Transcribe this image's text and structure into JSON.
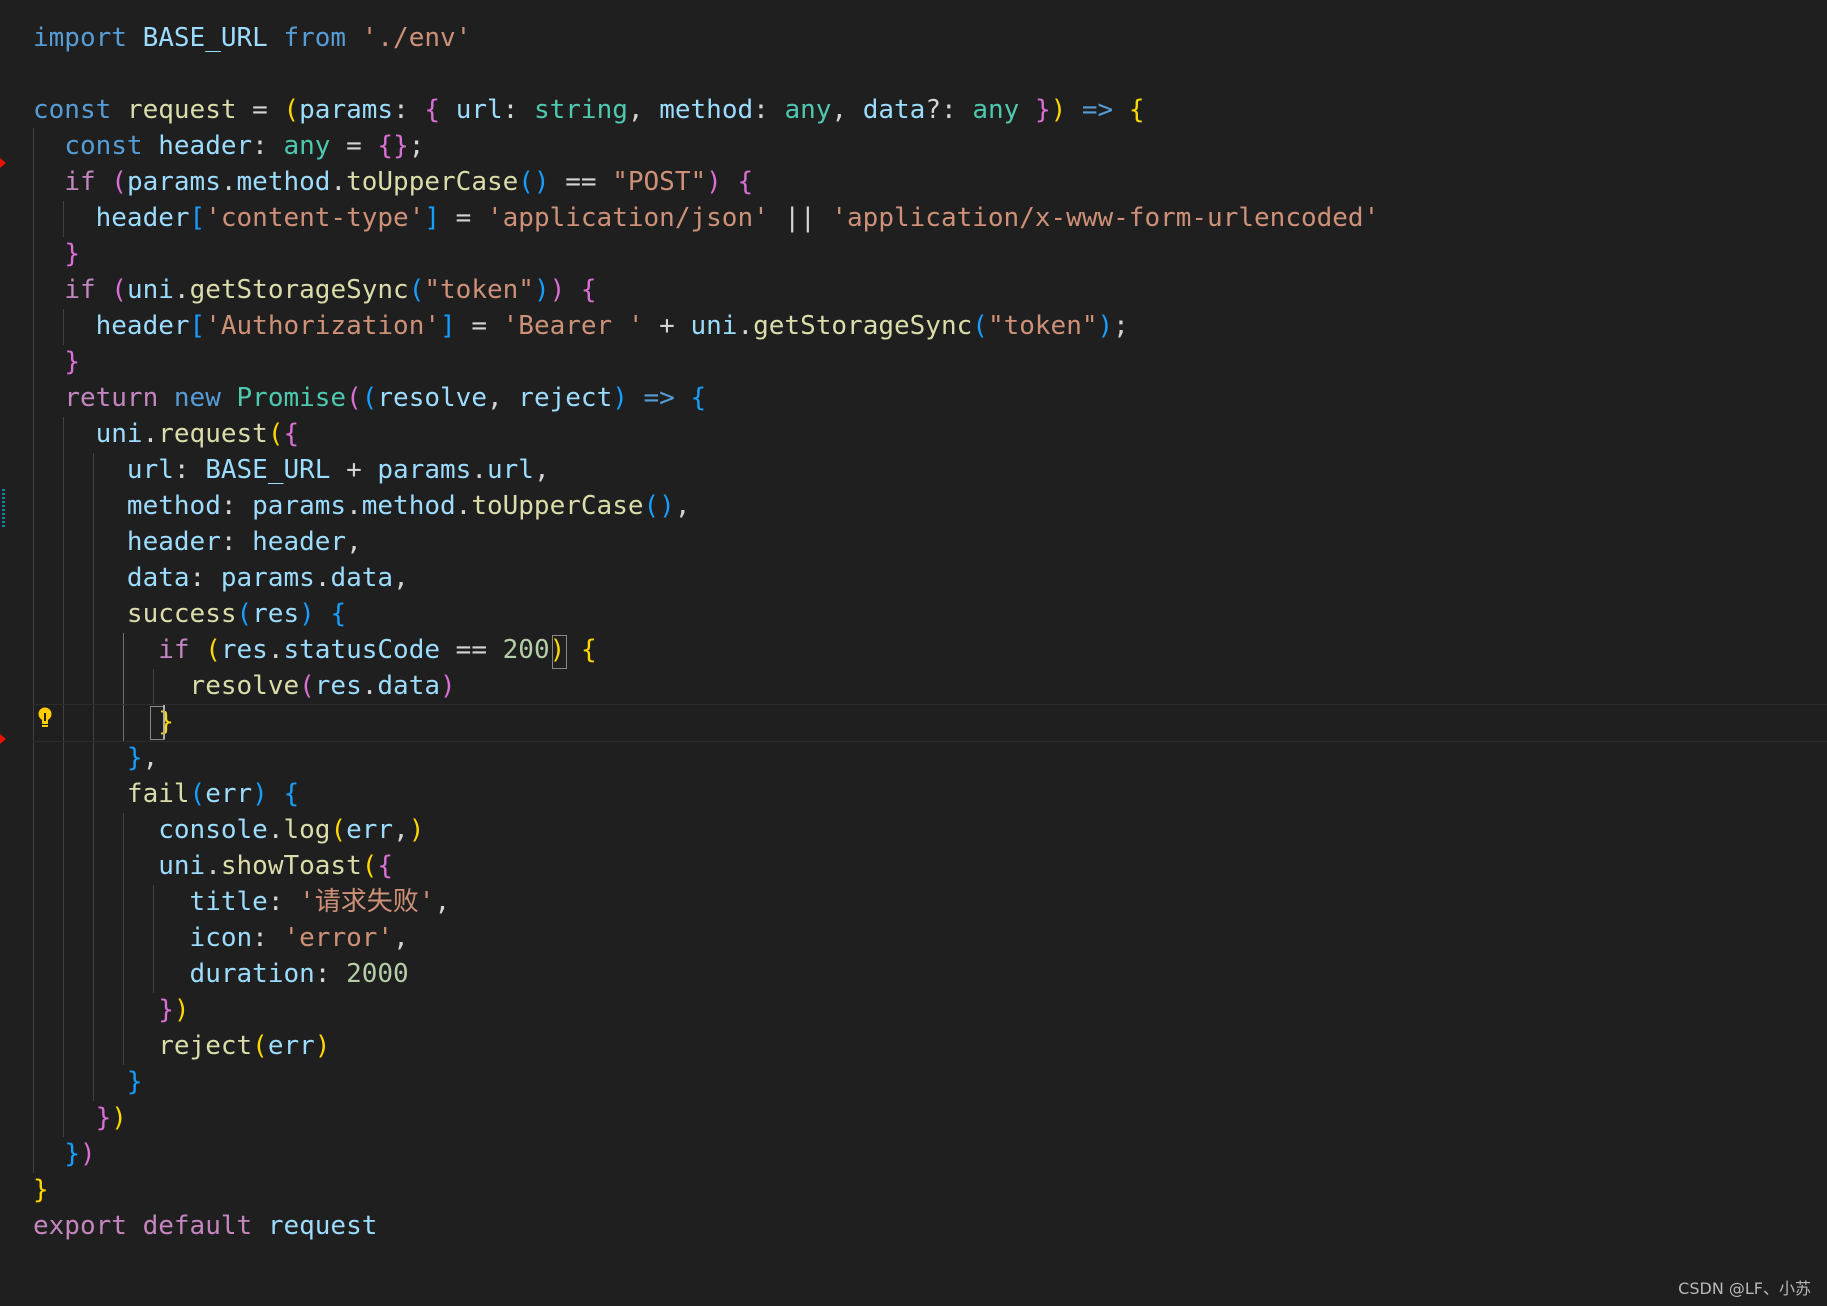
{
  "editor": {
    "language": "typescript",
    "lines": [
      [
        [
          "kw",
          "import"
        ],
        [
          "op",
          " "
        ],
        [
          "var",
          "BASE_URL"
        ],
        [
          "op",
          " "
        ],
        [
          "kw",
          "from"
        ],
        [
          "op",
          " "
        ],
        [
          "str",
          "'./env'"
        ]
      ],
      [],
      [
        [
          "kw",
          "const"
        ],
        [
          "op",
          " "
        ],
        [
          "fn",
          "request"
        ],
        [
          "op",
          " = "
        ],
        [
          "br1",
          "("
        ],
        [
          "var",
          "params"
        ],
        [
          "op",
          ": "
        ],
        [
          "br2",
          "{"
        ],
        [
          "op",
          " "
        ],
        [
          "var",
          "url"
        ],
        [
          "op",
          ": "
        ],
        [
          "type",
          "string"
        ],
        [
          "op",
          ", "
        ],
        [
          "var",
          "method"
        ],
        [
          "op",
          ": "
        ],
        [
          "type",
          "any"
        ],
        [
          "op",
          ", "
        ],
        [
          "var",
          "data"
        ],
        [
          "op",
          "?: "
        ],
        [
          "type",
          "any"
        ],
        [
          "op",
          " "
        ],
        [
          "br2",
          "}"
        ],
        [
          "br1",
          ")"
        ],
        [
          "op",
          " "
        ],
        [
          "kw",
          "=>"
        ],
        [
          "op",
          " "
        ],
        [
          "br1",
          "{"
        ]
      ],
      [
        [
          "op",
          "  "
        ],
        [
          "kw",
          "const"
        ],
        [
          "op",
          " "
        ],
        [
          "var",
          "header"
        ],
        [
          "op",
          ": "
        ],
        [
          "type",
          "any"
        ],
        [
          "op",
          " = "
        ],
        [
          "br2",
          "{}"
        ],
        [
          "op",
          ";"
        ]
      ],
      [
        [
          "op",
          "  "
        ],
        [
          "ctl",
          "if"
        ],
        [
          "op",
          " "
        ],
        [
          "br2",
          "("
        ],
        [
          "var",
          "params"
        ],
        [
          "op",
          "."
        ],
        [
          "var",
          "method"
        ],
        [
          "op",
          "."
        ],
        [
          "fn",
          "toUpperCase"
        ],
        [
          "br3",
          "()"
        ],
        [
          "op",
          " == "
        ],
        [
          "str",
          "\"POST\""
        ],
        [
          "br2",
          ")"
        ],
        [
          "op",
          " "
        ],
        [
          "br2",
          "{"
        ]
      ],
      [
        [
          "op",
          "    "
        ],
        [
          "var",
          "header"
        ],
        [
          "br3",
          "["
        ],
        [
          "str",
          "'content-type'"
        ],
        [
          "br3",
          "]"
        ],
        [
          "op",
          " = "
        ],
        [
          "str",
          "'application/json'"
        ],
        [
          "op",
          " || "
        ],
        [
          "str",
          "'application/x-www-form-urlencoded'"
        ]
      ],
      [
        [
          "op",
          "  "
        ],
        [
          "br2",
          "}"
        ]
      ],
      [
        [
          "op",
          "  "
        ],
        [
          "ctl",
          "if"
        ],
        [
          "op",
          " "
        ],
        [
          "br2",
          "("
        ],
        [
          "var",
          "uni"
        ],
        [
          "op",
          "."
        ],
        [
          "fn",
          "getStorageSync"
        ],
        [
          "br3",
          "("
        ],
        [
          "str",
          "\"token\""
        ],
        [
          "br3",
          ")"
        ],
        [
          "br2",
          ")"
        ],
        [
          "op",
          " "
        ],
        [
          "br2",
          "{"
        ]
      ],
      [
        [
          "op",
          "    "
        ],
        [
          "var",
          "header"
        ],
        [
          "br3",
          "["
        ],
        [
          "str",
          "'Authorization'"
        ],
        [
          "br3",
          "]"
        ],
        [
          "op",
          " = "
        ],
        [
          "str",
          "'Bearer '"
        ],
        [
          "op",
          " + "
        ],
        [
          "var",
          "uni"
        ],
        [
          "op",
          "."
        ],
        [
          "fn",
          "getStorageSync"
        ],
        [
          "br3",
          "("
        ],
        [
          "str",
          "\"token\""
        ],
        [
          "br3",
          ")"
        ],
        [
          "op",
          ";"
        ]
      ],
      [
        [
          "op",
          "  "
        ],
        [
          "br2",
          "}"
        ]
      ],
      [
        [
          "op",
          "  "
        ],
        [
          "ctl",
          "return"
        ],
        [
          "op",
          " "
        ],
        [
          "kw",
          "new"
        ],
        [
          "op",
          " "
        ],
        [
          "type",
          "Promise"
        ],
        [
          "br2",
          "("
        ],
        [
          "br3",
          "("
        ],
        [
          "var",
          "resolve"
        ],
        [
          "op",
          ", "
        ],
        [
          "var",
          "reject"
        ],
        [
          "br3",
          ")"
        ],
        [
          "op",
          " "
        ],
        [
          "kw",
          "=>"
        ],
        [
          "op",
          " "
        ],
        [
          "br3",
          "{"
        ]
      ],
      [
        [
          "op",
          "    "
        ],
        [
          "var",
          "uni"
        ],
        [
          "op",
          "."
        ],
        [
          "fn",
          "request"
        ],
        [
          "br1",
          "("
        ],
        [
          "br2",
          "{"
        ]
      ],
      [
        [
          "op",
          "      "
        ],
        [
          "var",
          "url"
        ],
        [
          "op",
          ": "
        ],
        [
          "var",
          "BASE_URL"
        ],
        [
          "op",
          " + "
        ],
        [
          "var",
          "params"
        ],
        [
          "op",
          "."
        ],
        [
          "var",
          "url"
        ],
        [
          "op",
          ","
        ]
      ],
      [
        [
          "op",
          "      "
        ],
        [
          "var",
          "method"
        ],
        [
          "op",
          ": "
        ],
        [
          "var",
          "params"
        ],
        [
          "op",
          "."
        ],
        [
          "var",
          "method"
        ],
        [
          "op",
          "."
        ],
        [
          "fn",
          "toUpperCase"
        ],
        [
          "br3",
          "()"
        ],
        [
          "op",
          ","
        ]
      ],
      [
        [
          "op",
          "      "
        ],
        [
          "var",
          "header"
        ],
        [
          "op",
          ": "
        ],
        [
          "var",
          "header"
        ],
        [
          "op",
          ","
        ]
      ],
      [
        [
          "op",
          "      "
        ],
        [
          "var",
          "data"
        ],
        [
          "op",
          ": "
        ],
        [
          "var",
          "params"
        ],
        [
          "op",
          "."
        ],
        [
          "var",
          "data"
        ],
        [
          "op",
          ","
        ]
      ],
      [
        [
          "op",
          "      "
        ],
        [
          "fn",
          "success"
        ],
        [
          "br3",
          "("
        ],
        [
          "var",
          "res"
        ],
        [
          "br3",
          ")"
        ],
        [
          "op",
          " "
        ],
        [
          "br3",
          "{"
        ]
      ],
      [
        [
          "op",
          "        "
        ],
        [
          "ctl",
          "if"
        ],
        [
          "op",
          " "
        ],
        [
          "br1",
          "("
        ],
        [
          "var",
          "res"
        ],
        [
          "op",
          "."
        ],
        [
          "var",
          "statusCode"
        ],
        [
          "op",
          " == "
        ],
        [
          "num",
          "200"
        ],
        [
          "br1",
          ")"
        ],
        [
          "op",
          " "
        ],
        [
          "br1",
          "{"
        ]
      ],
      [
        [
          "op",
          "          "
        ],
        [
          "fn",
          "resolve"
        ],
        [
          "br2",
          "("
        ],
        [
          "var",
          "res"
        ],
        [
          "op",
          "."
        ],
        [
          "var",
          "data"
        ],
        [
          "br2",
          ")"
        ]
      ],
      [
        [
          "op",
          "        "
        ],
        [
          "br1",
          "}"
        ]
      ],
      [
        [
          "op",
          "      "
        ],
        [
          "br3",
          "}"
        ],
        [
          "op",
          ","
        ]
      ],
      [
        [
          "op",
          "      "
        ],
        [
          "fn",
          "fail"
        ],
        [
          "br3",
          "("
        ],
        [
          "var",
          "err"
        ],
        [
          "br3",
          ")"
        ],
        [
          "op",
          " "
        ],
        [
          "br3",
          "{"
        ]
      ],
      [
        [
          "op",
          "        "
        ],
        [
          "var",
          "console"
        ],
        [
          "op",
          "."
        ],
        [
          "fn",
          "log"
        ],
        [
          "br1",
          "("
        ],
        [
          "var",
          "err"
        ],
        [
          "op",
          ","
        ],
        [
          "br1",
          ")"
        ]
      ],
      [
        [
          "op",
          "        "
        ],
        [
          "var",
          "uni"
        ],
        [
          "op",
          "."
        ],
        [
          "fn",
          "showToast"
        ],
        [
          "br1",
          "("
        ],
        [
          "br2",
          "{"
        ]
      ],
      [
        [
          "op",
          "          "
        ],
        [
          "var",
          "title"
        ],
        [
          "op",
          ": "
        ],
        [
          "str",
          "'请求失败'"
        ],
        [
          "op",
          ","
        ]
      ],
      [
        [
          "op",
          "          "
        ],
        [
          "var",
          "icon"
        ],
        [
          "op",
          ": "
        ],
        [
          "str",
          "'error'"
        ],
        [
          "op",
          ","
        ]
      ],
      [
        [
          "op",
          "          "
        ],
        [
          "var",
          "duration"
        ],
        [
          "op",
          ": "
        ],
        [
          "num",
          "2000"
        ]
      ],
      [
        [
          "op",
          "        "
        ],
        [
          "br2",
          "}"
        ],
        [
          "br1",
          ")"
        ]
      ],
      [
        [
          "op",
          "        "
        ],
        [
          "fn",
          "reject"
        ],
        [
          "br1",
          "("
        ],
        [
          "var",
          "err"
        ],
        [
          "br1",
          ")"
        ]
      ],
      [
        [
          "op",
          "      "
        ],
        [
          "br3",
          "}"
        ]
      ],
      [
        [
          "op",
          "    "
        ],
        [
          "br2",
          "}"
        ],
        [
          "br1",
          ")"
        ]
      ],
      [
        [
          "op",
          "  "
        ],
        [
          "br3",
          "}"
        ],
        [
          "br2",
          ")"
        ]
      ],
      [
        [
          "br1",
          "}"
        ]
      ],
      [
        [
          "ctl",
          "export"
        ],
        [
          "op",
          " "
        ],
        [
          "ctl",
          "default"
        ],
        [
          "op",
          " "
        ],
        [
          "var",
          "request"
        ]
      ]
    ]
  },
  "colors": {
    "background": "#1f1f1f",
    "keyword": "#569cd6",
    "control": "#c586c0",
    "variable": "#9cdcfe",
    "function": "#dcdcaa",
    "type": "#4ec9b0",
    "string": "#ce9178",
    "number": "#b5cea8"
  },
  "lightbulb_icon": "lightbulb-icon",
  "watermark": "CSDN @LF、小苏"
}
